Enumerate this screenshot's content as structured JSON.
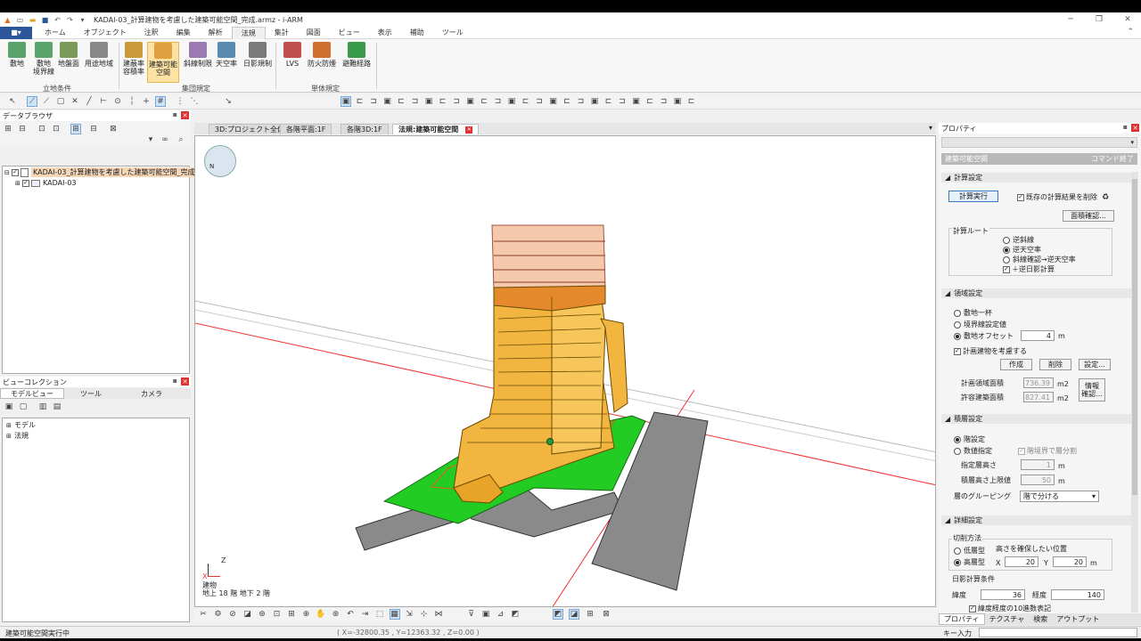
{
  "window": {
    "title": "KADAI-03_計算建物を考慮した建築可能空間_完成.armz - i-ARM"
  },
  "menubar": {
    "file": "■▾",
    "tabs": [
      "ホーム",
      "オブジェクト",
      "注釈",
      "編集",
      "解析",
      "法規",
      "集計",
      "図面",
      "ビュー",
      "表示",
      "補助",
      "ツール"
    ],
    "active_tab": "法規"
  },
  "ribbon": {
    "buttons": [
      {
        "label": "敷地",
        "color": "#5aa36a"
      },
      {
        "label": "敷地\n境界線",
        "color": "#5aa36a"
      },
      {
        "label": "地盤面",
        "color": "#7a9a5a"
      },
      {
        "label": "用途地域",
        "color": "#888"
      },
      {
        "label": "建蔽率\n容積率",
        "color": "#c89a3a"
      },
      {
        "label": "建築可能\n空間",
        "color": "#e0a040"
      },
      {
        "label": "斜線制限",
        "color": "#9a7ab0"
      },
      {
        "label": "天空率",
        "color": "#5a8ab0"
      },
      {
        "label": "日影規制",
        "color": "#7a7a7a"
      },
      {
        "label": "LVS",
        "color": "#c05050"
      },
      {
        "label": "防火防煙",
        "color": "#d07030"
      },
      {
        "label": "避難経路",
        "color": "#3a9a4a"
      }
    ],
    "groups": [
      "立地条件",
      "集団規定",
      "単体規定"
    ]
  },
  "data_browser": {
    "title": "データブラウザ",
    "root": "KADAI-03_計算建物を考慮した建築可能空間_完成",
    "child": "KADAI-03"
  },
  "view_collection": {
    "title": "ビューコレクション",
    "tabs": [
      "モデルビュー",
      "ツール",
      "カメラ"
    ],
    "items": [
      "モデル",
      "法規"
    ]
  },
  "view_tabs": [
    "3D:プロジェクト全体",
    "各階平面:1F",
    "各階3D:1F",
    "法規:建築可能空間"
  ],
  "active_view": "法規:建築可能空間",
  "viewport": {
    "axis_z": "Z",
    "axis_x": "X",
    "info_building": "建物",
    "info_floors": "地上 18 階 地下 2 階"
  },
  "status": {
    "left": "建築可能空間実行中",
    "coords": "( X=-32800.35 , Y=12363.32 , Z=0.00 )",
    "key_label": "キー入力"
  },
  "properties": {
    "title": "プロパティ",
    "header": "建築可能空間",
    "end_cmd": "コマンド終了",
    "sec_calc": "計算設定",
    "run_btn": "計算実行",
    "delete_prev": "既存の計算結果を削除",
    "area_check": "面積確認...",
    "route_label": "計算ルート",
    "routes": [
      "逆斜線",
      "逆天空率",
      "斜線確認→逆天空率"
    ],
    "route_selected": 1,
    "route_shadow": "＋逆日影計算",
    "sec_region": "領域設定",
    "regions": [
      "敷地一杯",
      "境界線設定値",
      "敷地オフセット"
    ],
    "region_selected": 2,
    "offset_value": "4",
    "unit_m": "m",
    "consider_bldg": "計画建物を考慮する",
    "create": "作成",
    "delete": "削除",
    "settings": "設定...",
    "plan_area_label": "計画領域面積",
    "plan_area": "736.39",
    "allow_area_label": "許容建築面積",
    "allow_area": "827.41",
    "unit_m2": "m2",
    "info_btn": "情報\n確認...",
    "sec_layer": "積層設定",
    "layers": [
      "階設定",
      "数値指定"
    ],
    "layer_selected": 0,
    "layer_split": "階境界で層分割",
    "layer_height_label": "指定層高さ",
    "layer_height": "1",
    "layer_limit_label": "積層高さ上限値",
    "layer_limit": "50",
    "grouping_label": "層のグルーピング",
    "grouping_value": "階で分ける",
    "sec_detail": "詳細設定",
    "cut_label": "切削方法",
    "cut_types": [
      "低層型",
      "高層型"
    ],
    "cut_selected": 1,
    "cut_note": "高さを確保したい位置",
    "x_label": "X",
    "x_val": "20",
    "y_label": "Y",
    "y_val": "20",
    "shadow_label": "日影計算条件",
    "lat_label": "緯度",
    "lat": "36",
    "lon_label": "経度",
    "lon": "140",
    "more": "緯度経度の10進数表記",
    "bottom_tabs": [
      "プロパティ",
      "テクスチャ",
      "検索",
      "アウトプット"
    ]
  },
  "colors": {
    "accent": "#2b579a",
    "building": "#f2b640",
    "site": "#22cc22",
    "road": "#8a8a8a"
  }
}
